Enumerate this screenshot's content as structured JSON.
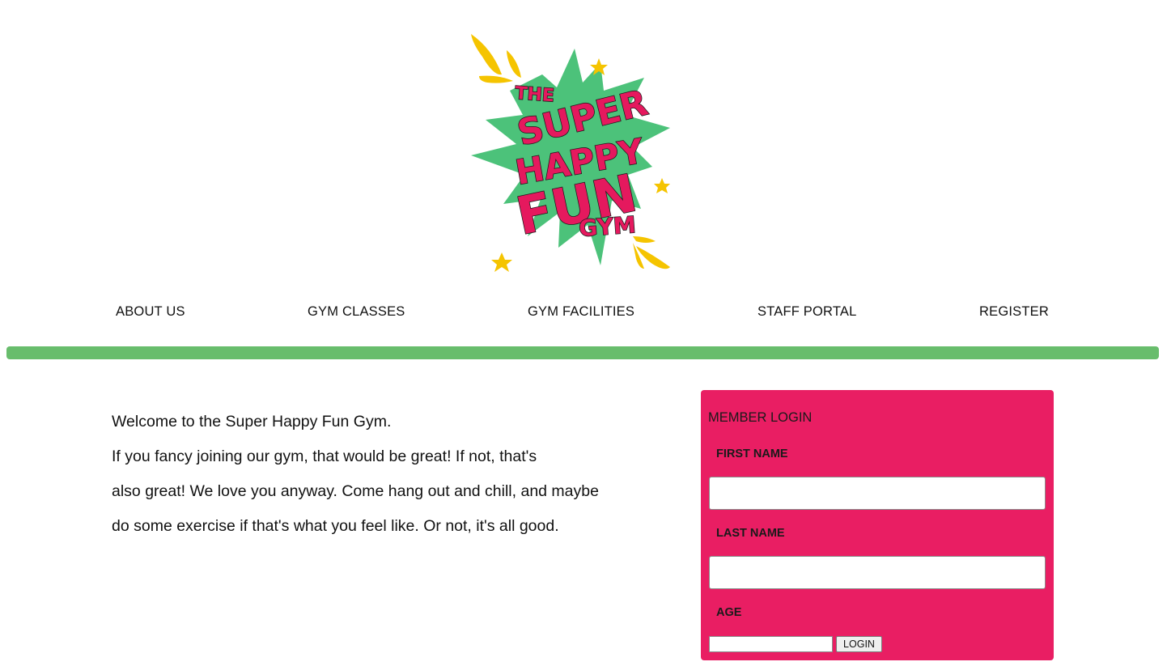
{
  "logo": {
    "line1": "THE",
    "line2": "SUPER",
    "line3": "HAPPY",
    "line4": "FUN",
    "line5": "GYM",
    "colors": {
      "burst": "#4cc27a",
      "text": "#e5195e",
      "accent": "#f5c400"
    }
  },
  "nav": {
    "items": [
      {
        "label": "ABOUT US"
      },
      {
        "label": "GYM CLASSES"
      },
      {
        "label": "GYM FACILITIES"
      },
      {
        "label": "STAFF PORTAL"
      },
      {
        "label": "REGISTER"
      }
    ]
  },
  "divider": {
    "color": "#68bd6c"
  },
  "welcome": {
    "paragraph1": "Welcome to the Super Happy Fun Gym.",
    "paragraph2": "If you fancy joining our gym, that would be great! If not, that's",
    "paragraph3": "also great! We love you anyway. Come hang out and chill, and maybe",
    "paragraph4": "do some exercise if that's what you feel like. Or not, it's all good."
  },
  "login": {
    "title": "MEMBER LOGIN",
    "first_name_label": "FIRST NAME",
    "first_name_value": "",
    "last_name_label": "LAST NAME",
    "last_name_value": "",
    "age_label": "AGE",
    "age_value": "",
    "button_label": "LOGIN",
    "background_color": "#e91e63"
  }
}
